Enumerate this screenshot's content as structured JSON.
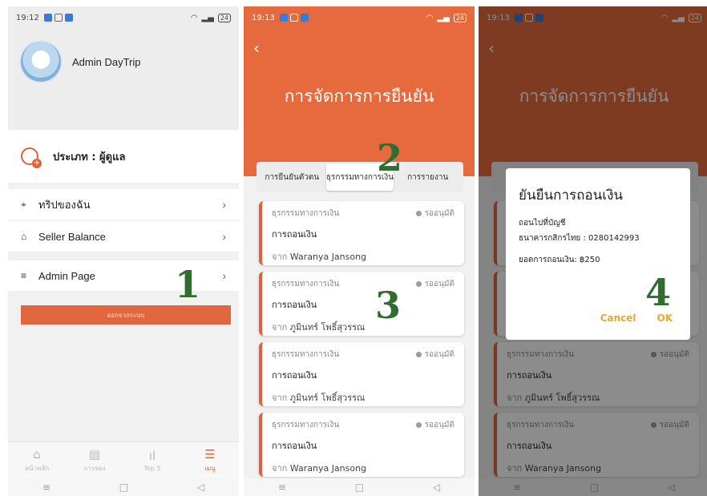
{
  "screen1": {
    "status": {
      "time": "19:12",
      "battery": "24"
    },
    "admin_name": "Admin DayTrip",
    "type_label": "ประเภท : ผู้ดูแล",
    "menu": [
      {
        "label": "ทริปของฉัน",
        "icon": "location-pin-icon"
      },
      {
        "label": "Seller Balance",
        "icon": "bank-icon"
      },
      {
        "label": "Admin Page",
        "icon": "admin-list-icon"
      }
    ],
    "logout_label": "ออกจากระบบ",
    "bottom_nav": [
      {
        "label": "หน้าหลัก",
        "icon": "home-icon"
      },
      {
        "label": "การจอง",
        "icon": "booking-icon"
      },
      {
        "label": "Top 5",
        "icon": "chart-icon"
      },
      {
        "label": "เมนู",
        "icon": "menu-icon"
      }
    ],
    "step_number": "1"
  },
  "screen2": {
    "status": {
      "time": "19:13",
      "battery": "24"
    },
    "title": "การจัดการการยืนยัน",
    "tabs": [
      {
        "label": "การยืนยันตัวตน"
      },
      {
        "label": "ธุรกรรมทางการเงิน"
      },
      {
        "label": "การรายงาน"
      }
    ],
    "cards": [
      {
        "category": "ธุรกรรมทางการเงิน",
        "status": "รออนุมัติ",
        "type": "การถอนเงิน",
        "from_prefix": "จาก",
        "from": "Waranya Jansong"
      },
      {
        "category": "ธุรกรรมทางการเงิน",
        "status": "รออนุมัติ",
        "type": "การถอนเงิน",
        "from_prefix": "จาก",
        "from": "ภูมินทร์ โพธิ์สุวรรณ"
      },
      {
        "category": "ธุรกรรมทางการเงิน",
        "status": "รออนุมัติ",
        "type": "การถอนเงิน",
        "from_prefix": "จาก",
        "from": "ภูมินทร์ โพธิ์สุวรรณ"
      },
      {
        "category": "ธุรกรรมทางการเงิน",
        "status": "รออนุมัติ",
        "type": "การถอนเงิน",
        "from_prefix": "จาก",
        "from": "Waranya Jansong"
      }
    ],
    "step_number_tab": "2",
    "step_number_card": "3"
  },
  "screen3": {
    "status": {
      "time": "19:13",
      "battery": "24"
    },
    "title": "การจัดการการยืนยัน",
    "dialog": {
      "title": "ยันยืนการถอนเงิน",
      "account_line1": "ถอนไปที่บัญชี",
      "account_line2": "ธนาคารกสิกรไทย : 0280142993",
      "amount": "ยอดการถอนเงิน: ฿250",
      "cancel": "Cancel",
      "ok": "OK"
    },
    "cards": [
      {
        "category": "ธุรกรรมทางการเงิน",
        "status": "รออนุมัติ",
        "type": "การถอนเงิน",
        "from_prefix": "จาก",
        "from": "ภูมินทร์ โพธิ์สุวรรณ"
      },
      {
        "category": "ธุรกรรมทางการเงิน",
        "status": "รออนุมัติ",
        "type": "การถอนเงิน",
        "from_prefix": "จาก",
        "from": "Waranya Jansong"
      }
    ],
    "step_number": "4"
  },
  "colors": {
    "accent": "#e76a3e",
    "step_number": "#2f6e2e",
    "dialog_button": "#e8a838"
  }
}
